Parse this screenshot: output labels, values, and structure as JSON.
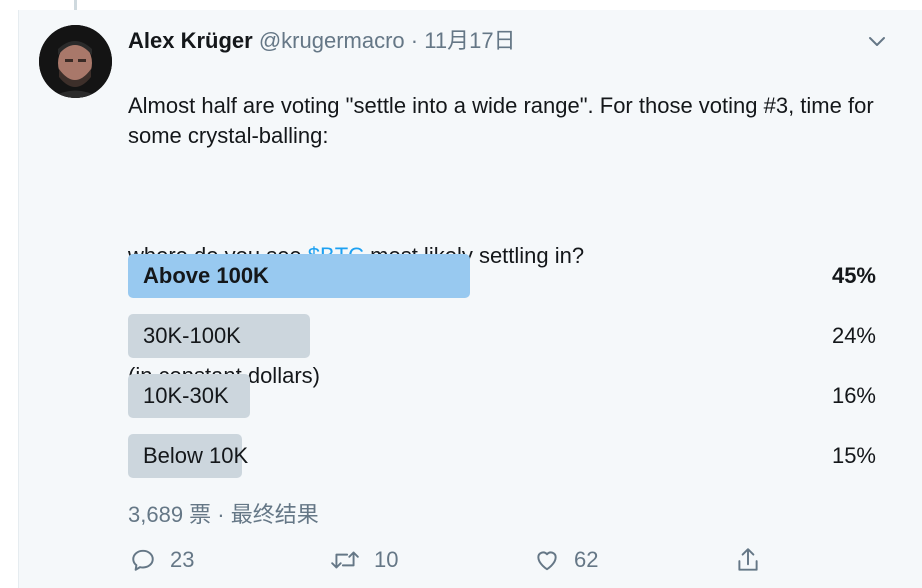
{
  "tweet": {
    "display_name": "Alex Krüger",
    "handle": "@krugermacro",
    "separator": "·",
    "timestamp": "11月17日",
    "text_line1": "Almost half are voting \"settle into a wide range\". For those voting #3, time for some crystal-balling:",
    "text_q_before": "where do you see ",
    "cashtag": "$BTC",
    "text_q_after": " most likely settling in?",
    "text_note": "(in constant dollars)"
  },
  "poll": {
    "options": [
      {
        "label": "Above 100K",
        "percent_text": "45%",
        "share": 0.45,
        "winner": true
      },
      {
        "label": "30K-100K",
        "percent_text": "24%",
        "share": 0.24,
        "winner": false
      },
      {
        "label": "10K-30K",
        "percent_text": "16%",
        "share": 0.16,
        "winner": false
      },
      {
        "label": "Below 10K",
        "percent_text": "15%",
        "share": 0.15,
        "winner": false
      }
    ],
    "meta": "3,689 票 · 最终结果"
  },
  "actions": {
    "reply_count": "23",
    "retweet_count": "10",
    "like_count": "62"
  },
  "colors": {
    "winner_bar": "#98c9f0",
    "bar": "#ccd6dd",
    "link": "#1da1f2",
    "muted": "#657786"
  },
  "icons": [
    "chevron-down-icon",
    "reply-icon",
    "retweet-icon",
    "like-icon",
    "share-icon"
  ]
}
